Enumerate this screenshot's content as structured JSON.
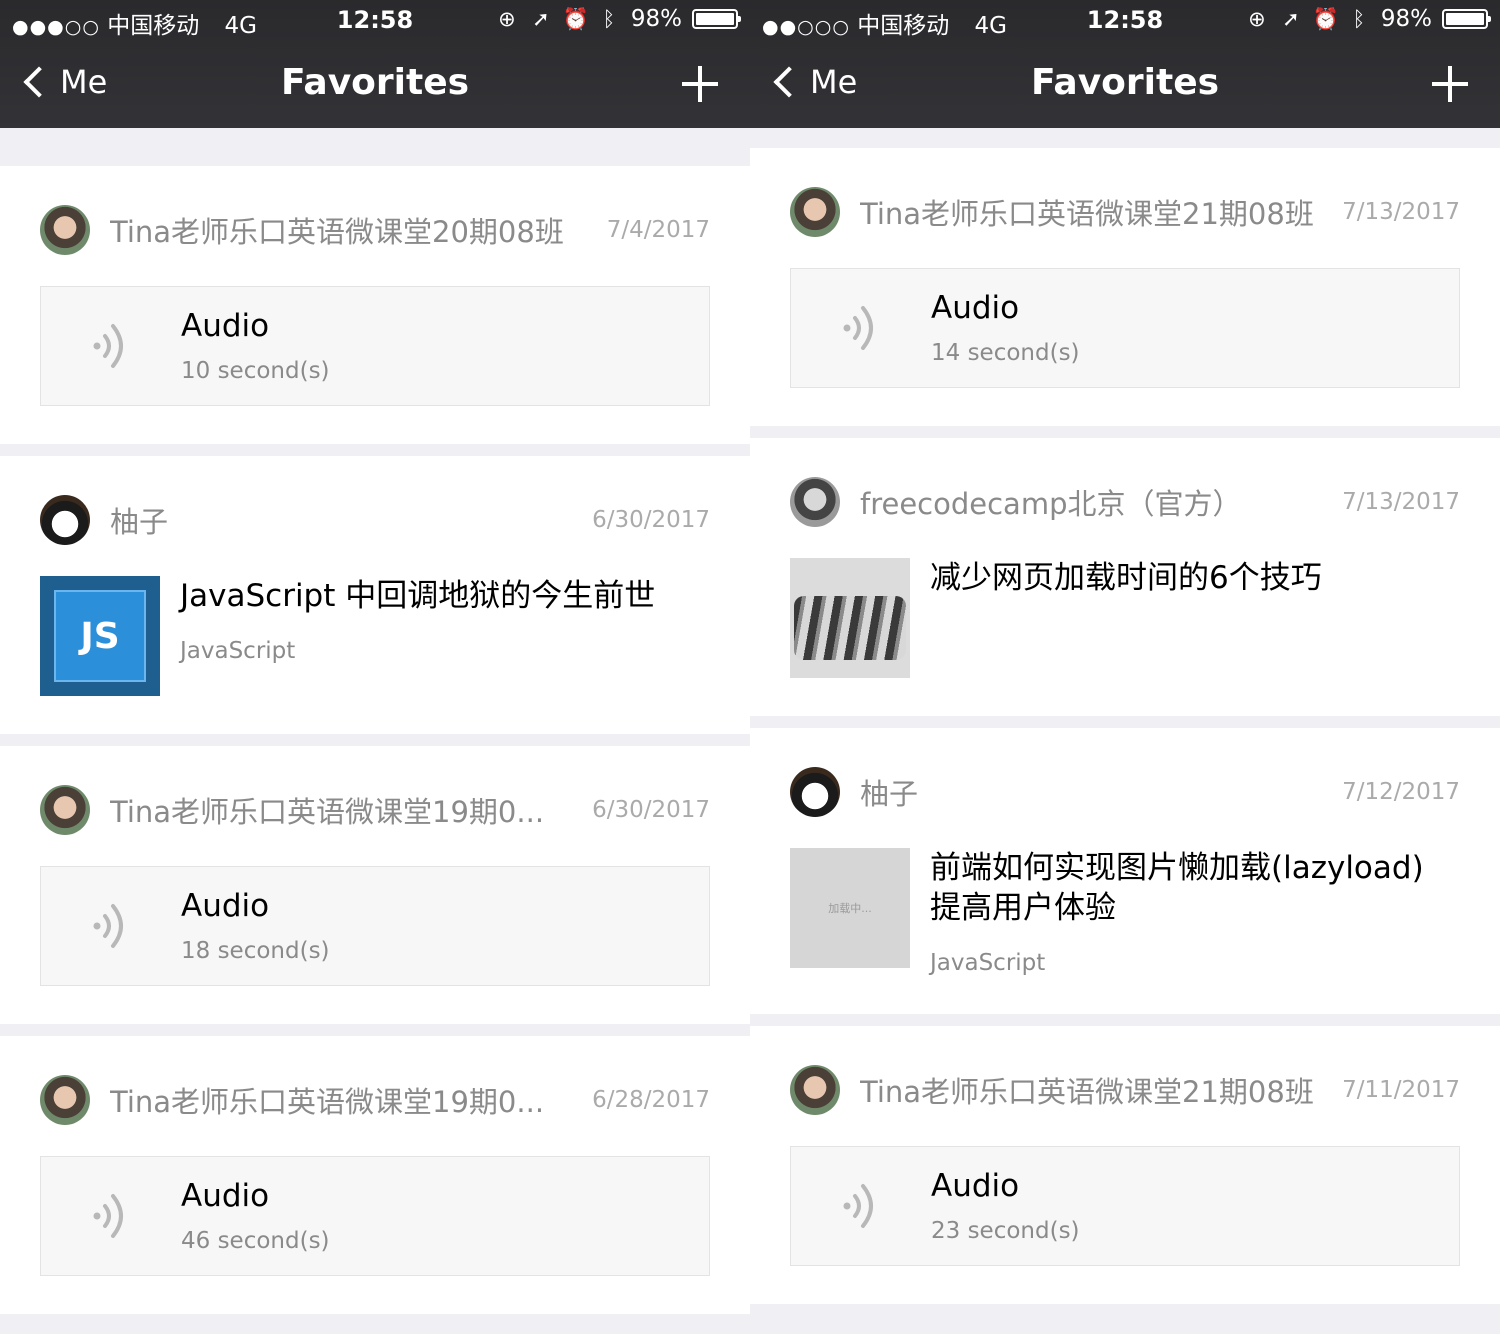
{
  "screens": [
    {
      "status": {
        "signal": "●●●○○",
        "carrier": "中国移动",
        "network": "4G",
        "time": "12:58",
        "battery": "98%",
        "battery_level": 0.98
      },
      "nav": {
        "back_label": "Me",
        "title": "Favorites"
      },
      "items": [
        {
          "sender": "Tina老师乐口英语微课堂20期08班",
          "date": "7/4/2017",
          "title": "Audio",
          "subtitle": "10 second(s)"
        },
        {
          "sender": "柚子",
          "date": "6/30/2017",
          "title": "JavaScript 中回调地狱的今生前世",
          "subtitle": "JavaScript",
          "thumb_text": "JS"
        },
        {
          "sender": "Tina老师乐口英语微课堂19期0...",
          "date": "6/30/2017",
          "title": "Audio",
          "subtitle": "18 second(s)"
        },
        {
          "sender": "Tina老师乐口英语微课堂19期0...",
          "date": "6/28/2017",
          "title": "Audio",
          "subtitle": "46 second(s)"
        }
      ]
    },
    {
      "status": {
        "signal": "●●○○○",
        "carrier": "中国移动",
        "network": "4G",
        "time": "12:58",
        "battery": "98%",
        "battery_level": 0.98
      },
      "nav": {
        "back_label": "Me",
        "title": "Favorites"
      },
      "items": [
        {
          "sender": "Tina老师乐口英语微课堂21期08班",
          "date": "7/13/2017",
          "title": "Audio",
          "subtitle": "14 second(s)"
        },
        {
          "sender": "freecodecamp北京（官方）",
          "date": "7/13/2017",
          "title": "减少网页加载时间的6个技巧"
        },
        {
          "sender": "柚子",
          "date": "7/12/2017",
          "title": "前端如何实现图片懒加载(lazyload) 提高用户体验",
          "subtitle": "JavaScript",
          "thumb_text": "加载中..."
        },
        {
          "sender": "Tina老师乐口英语微课堂21期08班",
          "date": "7/11/2017",
          "title": "Audio",
          "subtitle": "23 second(s)"
        }
      ]
    }
  ],
  "colors": {
    "header_bg": "#2f2f32",
    "page_bg": "#efeff4",
    "meta_text": "#8a8a8a",
    "date_text": "#aaaaaa"
  },
  "icons": [
    "back-chevron-icon",
    "plus-icon",
    "audio-wave-icon",
    "lock-rotation-icon",
    "location-arrow-icon",
    "alarm-icon",
    "bluetooth-icon",
    "battery-icon"
  ]
}
